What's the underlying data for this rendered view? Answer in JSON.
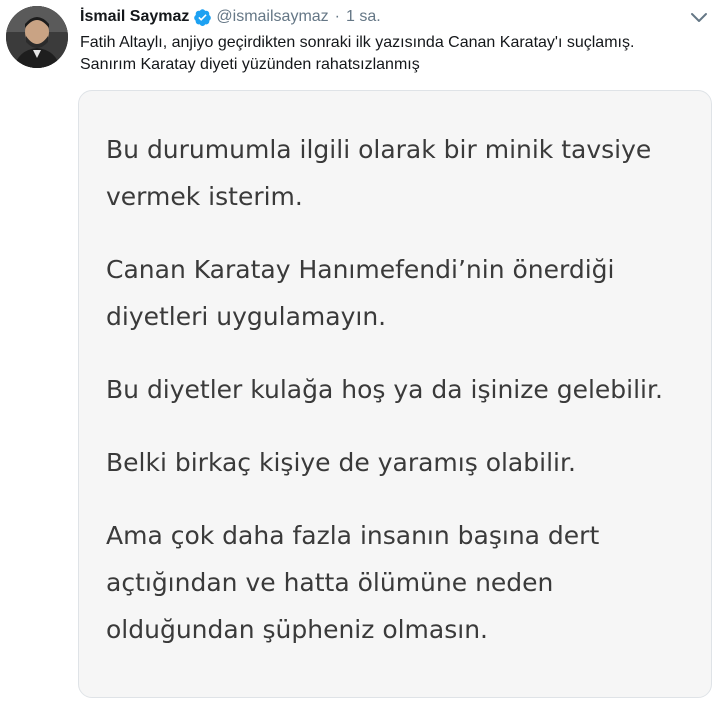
{
  "user": {
    "name": "İsmail Saymaz",
    "handle": "@ismailsaymaz",
    "separator": "·",
    "time": "1 sa.",
    "avatar_icon": "avatar",
    "verified_icon": "verified-badge-icon",
    "menu_icon": "chevron-down-icon"
  },
  "tweet": {
    "text_lines": [
      "Fatih Altaylı, anjiyo geçirdikten sonraki ilk yazısında Canan Karatay'ı suçlamış.",
      "Sanırım Karatay diyeti yüzünden rahatsızlanmış"
    ]
  },
  "media": {
    "paragraphs": [
      "Bu durumumla ilgili olarak bir minik tavsiye vermek isterim.",
      "Canan Karatay Hanımefendi’nin önerdiği diyetleri uygulamayın.",
      "Bu diyetler kulağa hoş ya da işinize gelebilir.",
      "Belki birkaç kişiye de yaramış olabilir.",
      "Ama çok daha fazla insanın başına dert açtığından ve hatta ölümüne neden olduğundan şüpheniz olmasın."
    ]
  },
  "colors": {
    "verified_blue": "#1da1f2",
    "muted_text": "#657786",
    "primary_text": "#14171a",
    "card_background": "#f6f6f6"
  }
}
